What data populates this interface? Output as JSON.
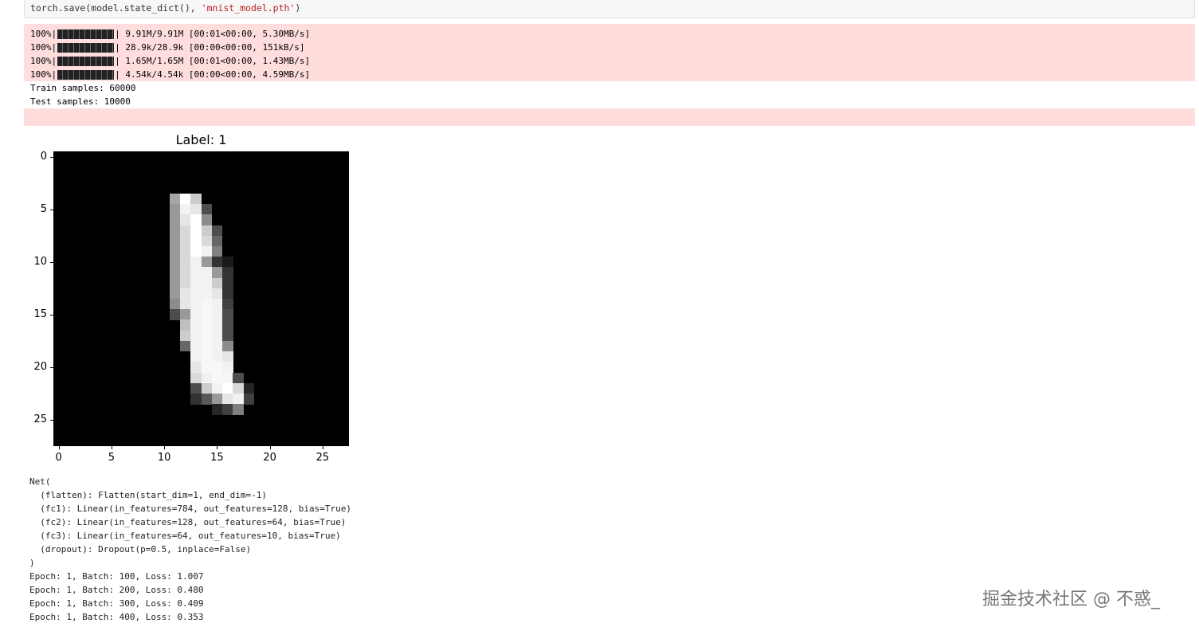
{
  "code": {
    "prefix": "torch.save(model.state_dict(), ",
    "string": "'mnist_model.pth'",
    "suffix": ")"
  },
  "stderr_progress": [
    {
      "percent": "100%|",
      "bar_fraction": 1.0,
      "detail": "| 9.91M/9.91M [00:01<00:00, 5.30MB/s]"
    },
    {
      "percent": "100%|",
      "bar_fraction": 1.0,
      "detail": "| 28.9k/28.9k [00:00<00:00, 151kB/s]"
    },
    {
      "percent": "100%|",
      "bar_fraction": 1.0,
      "detail": "| 1.65M/1.65M [00:01<00:00, 1.43MB/s]"
    },
    {
      "percent": "100%|",
      "bar_fraction": 1.0,
      "detail": "| 4.54k/4.54k [00:00<00:00, 4.59MB/s]"
    }
  ],
  "stdout": [
    "Train samples: 60000",
    "Test samples: 10000"
  ],
  "chart_data": {
    "type": "heatmap",
    "title": "Label: 1",
    "xlim": [
      -0.5,
      27.5
    ],
    "ylim": [
      27.5,
      -0.5
    ],
    "xticks": [
      "0",
      "5",
      "10",
      "15",
      "20",
      "25"
    ],
    "yticks": [
      "0",
      "5",
      "10",
      "15",
      "20",
      "25"
    ],
    "colormap": "gray",
    "pixels": [
      [
        4,
        11,
        0.65
      ],
      [
        4,
        12,
        1.0
      ],
      [
        4,
        13,
        0.8
      ],
      [
        5,
        11,
        0.6
      ],
      [
        5,
        12,
        0.95
      ],
      [
        5,
        13,
        0.9
      ],
      [
        5,
        14,
        0.3
      ],
      [
        6,
        11,
        0.6
      ],
      [
        6,
        12,
        0.9
      ],
      [
        6,
        13,
        1.0
      ],
      [
        6,
        14,
        0.55
      ],
      [
        7,
        11,
        0.6
      ],
      [
        7,
        12,
        0.85
      ],
      [
        7,
        13,
        1.0
      ],
      [
        7,
        14,
        0.8
      ],
      [
        7,
        15,
        0.3
      ],
      [
        8,
        11,
        0.6
      ],
      [
        8,
        12,
        0.85
      ],
      [
        8,
        13,
        1.0
      ],
      [
        8,
        14,
        0.85
      ],
      [
        8,
        15,
        0.4
      ],
      [
        9,
        11,
        0.6
      ],
      [
        9,
        12,
        0.85
      ],
      [
        9,
        13,
        1.0
      ],
      [
        9,
        14,
        0.95
      ],
      [
        9,
        15,
        0.5
      ],
      [
        10,
        11,
        0.6
      ],
      [
        10,
        12,
        0.85
      ],
      [
        10,
        13,
        0.95
      ],
      [
        10,
        14,
        0.6
      ],
      [
        10,
        15,
        0.2
      ],
      [
        10,
        16,
        0.1
      ],
      [
        11,
        11,
        0.6
      ],
      [
        11,
        12,
        0.85
      ],
      [
        11,
        13,
        0.95
      ],
      [
        11,
        14,
        0.95
      ],
      [
        11,
        15,
        0.6
      ],
      [
        11,
        16,
        0.2
      ],
      [
        12,
        11,
        0.6
      ],
      [
        12,
        12,
        0.85
      ],
      [
        12,
        13,
        0.95
      ],
      [
        12,
        14,
        0.95
      ],
      [
        12,
        15,
        0.8
      ],
      [
        12,
        16,
        0.2
      ],
      [
        13,
        11,
        0.6
      ],
      [
        13,
        12,
        0.9
      ],
      [
        13,
        13,
        0.95
      ],
      [
        13,
        14,
        0.95
      ],
      [
        13,
        15,
        0.9
      ],
      [
        13,
        16,
        0.2
      ],
      [
        14,
        11,
        0.55
      ],
      [
        14,
        12,
        0.9
      ],
      [
        14,
        13,
        0.95
      ],
      [
        14,
        14,
        0.97
      ],
      [
        14,
        15,
        0.95
      ],
      [
        14,
        16,
        0.25
      ],
      [
        15,
        11,
        0.3
      ],
      [
        15,
        12,
        0.6
      ],
      [
        15,
        13,
        0.95
      ],
      [
        15,
        14,
        0.97
      ],
      [
        15,
        15,
        0.95
      ],
      [
        15,
        16,
        0.3
      ],
      [
        16,
        12,
        0.75
      ],
      [
        16,
        13,
        0.95
      ],
      [
        16,
        14,
        0.97
      ],
      [
        16,
        15,
        0.95
      ],
      [
        16,
        16,
        0.3
      ],
      [
        17,
        12,
        0.8
      ],
      [
        17,
        13,
        0.95
      ],
      [
        17,
        14,
        0.97
      ],
      [
        17,
        15,
        0.95
      ],
      [
        17,
        16,
        0.3
      ],
      [
        18,
        12,
        0.4
      ],
      [
        18,
        13,
        0.95
      ],
      [
        18,
        14,
        0.97
      ],
      [
        18,
        15,
        0.95
      ],
      [
        18,
        16,
        0.55
      ],
      [
        19,
        13,
        0.95
      ],
      [
        19,
        14,
        0.97
      ],
      [
        19,
        15,
        0.95
      ],
      [
        19,
        16,
        0.9
      ],
      [
        20,
        13,
        0.9
      ],
      [
        20,
        14,
        0.97
      ],
      [
        20,
        15,
        0.97
      ],
      [
        20,
        16,
        0.95
      ],
      [
        21,
        13,
        0.85
      ],
      [
        21,
        14,
        0.95
      ],
      [
        21,
        15,
        0.97
      ],
      [
        21,
        16,
        0.97
      ],
      [
        21,
        17,
        0.3
      ],
      [
        22,
        13,
        0.3
      ],
      [
        22,
        14,
        0.8
      ],
      [
        22,
        15,
        0.95
      ],
      [
        22,
        16,
        1.0
      ],
      [
        22,
        17,
        0.85
      ],
      [
        22,
        18,
        0.15
      ],
      [
        23,
        13,
        0.2
      ],
      [
        23,
        14,
        0.35
      ],
      [
        23,
        15,
        0.6
      ],
      [
        23,
        16,
        0.9
      ],
      [
        23,
        17,
        0.95
      ],
      [
        23,
        18,
        0.25
      ],
      [
        24,
        15,
        0.15
      ],
      [
        24,
        16,
        0.25
      ],
      [
        24,
        17,
        0.5
      ]
    ]
  },
  "model_repr": [
    "Net(",
    "  (flatten): Flatten(start_dim=1, end_dim=-1)",
    "  (fc1): Linear(in_features=784, out_features=128, bias=True)",
    "  (fc2): Linear(in_features=128, out_features=64, bias=True)",
    "  (fc3): Linear(in_features=64, out_features=10, bias=True)",
    "  (dropout): Dropout(p=0.5, inplace=False)",
    ")"
  ],
  "training_log": [
    "Epoch: 1, Batch: 100, Loss: 1.007",
    "Epoch: 1, Batch: 200, Loss: 0.480",
    "Epoch: 1, Batch: 300, Loss: 0.409",
    "Epoch: 1, Batch: 400, Loss: 0.353"
  ],
  "watermark": "掘金技术社区 @ 不惑_"
}
